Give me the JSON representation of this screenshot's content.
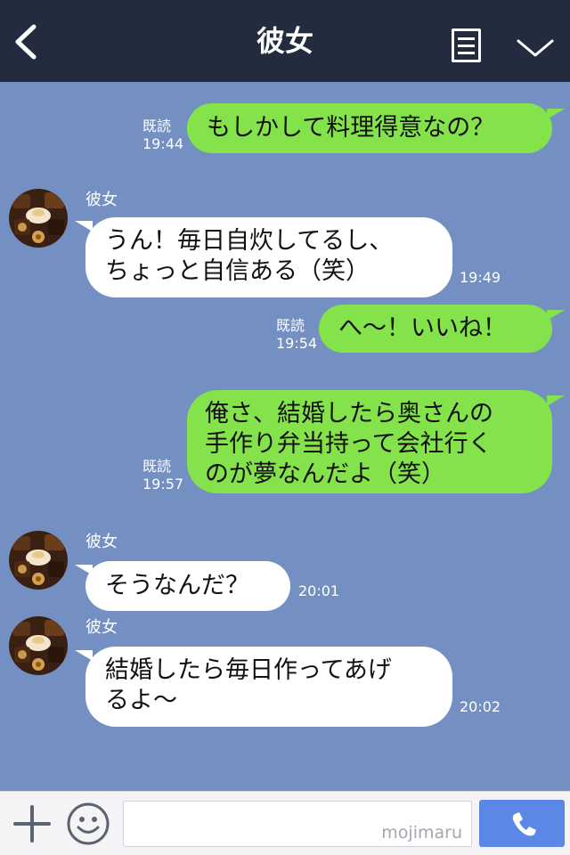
{
  "header": {
    "title": "彼女",
    "back_icon": "chevron-left-icon",
    "menu_icon": "list-icon",
    "expand_icon": "chevron-down-icon"
  },
  "messages": [
    {
      "direction": "out",
      "text": "もしかして料理得意なの？",
      "read": "既読",
      "time": "19:44"
    },
    {
      "direction": "in",
      "sender": "彼女",
      "text": "うん！毎日自炊してるし、\nちょっと自信ある（笑）",
      "time": "19:49"
    },
    {
      "direction": "out",
      "text": "へ〜！いいね！",
      "read": "既読",
      "time": "19:54"
    },
    {
      "direction": "out",
      "text": "俺さ、結婚したら奥さんの\n手作り弁当持って会社行く\nのが夢なんだよ（笑）",
      "read": "既読",
      "time": "19:57"
    },
    {
      "direction": "in",
      "sender": "彼女",
      "text": "そうなんだ？",
      "time": "20:01"
    },
    {
      "direction": "in",
      "sender": "彼女",
      "text": "結婚したら毎日作ってあげ\nるよ〜",
      "time": "20:02"
    }
  ],
  "input_bar": {
    "plus_icon": "plus-icon",
    "emoji_icon": "smiley-icon",
    "input_value": "",
    "watermark": "mojimaru",
    "send_icon": "phone-icon"
  },
  "colors": {
    "header_bg": "#232b3f",
    "chat_bg": "#7490c2",
    "outgoing_bubble": "#84e34b",
    "incoming_bubble": "#ffffff",
    "send_button": "#5b88e6"
  }
}
